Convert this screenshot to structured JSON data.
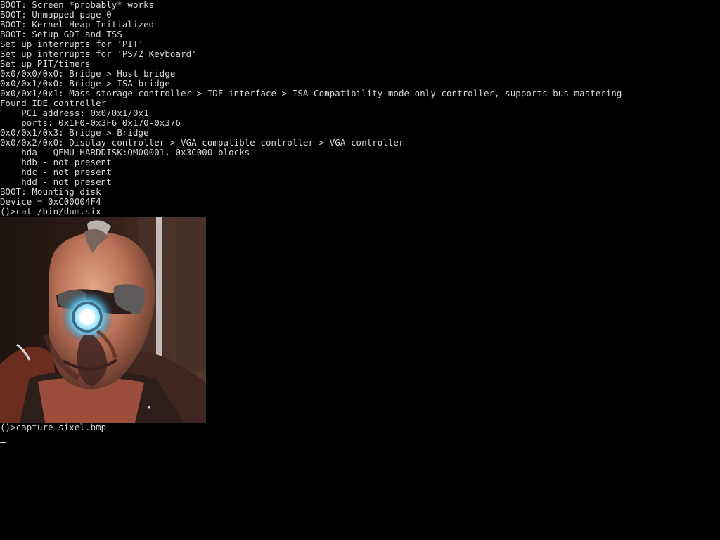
{
  "terminal": {
    "boot_log": [
      "BOOT: Screen *probably* works",
      "BOOT: Unmapped page 0",
      "BOOT: Kernel Heap Initialized",
      "BOOT: Setup GDT and TSS",
      "Set up interrupts for 'PIT'",
      "Set up interrupts for 'PS/2 Keyboard'",
      "Set up PIT/timers",
      "0x0/0x0/0x0: Bridge > Host bridge",
      "0x0/0x1/0x0: Bridge > ISA bridge",
      "0x0/0x1/0x1: Mass storage controller > IDE interface > ISA Compatibility mode-only controller, supports bus mastering",
      "Found IDE controller",
      "    PCI address: 0x0/0x1/0x1",
      "    ports: 0x1F0-0x3F6 0x170-0x376",
      "0x0/0x1/0x3: Bridge > Bridge",
      "0x0/0x2/0x0: Display controller > VGA compatible controller > VGA controller",
      "    hda - QEMU HARDDISK:QM00001, 0x3C000 blocks",
      "    hdb - not present",
      "    hdc - not present",
      "    hdd - not present",
      "BOOT: Mounting disk",
      "Device = 0xC00004F4",
      "()>cat /bin/dum.six"
    ],
    "after_image": [
      "()>capture sixel.bmp"
    ],
    "image_icon": "cyborg-face-image"
  }
}
